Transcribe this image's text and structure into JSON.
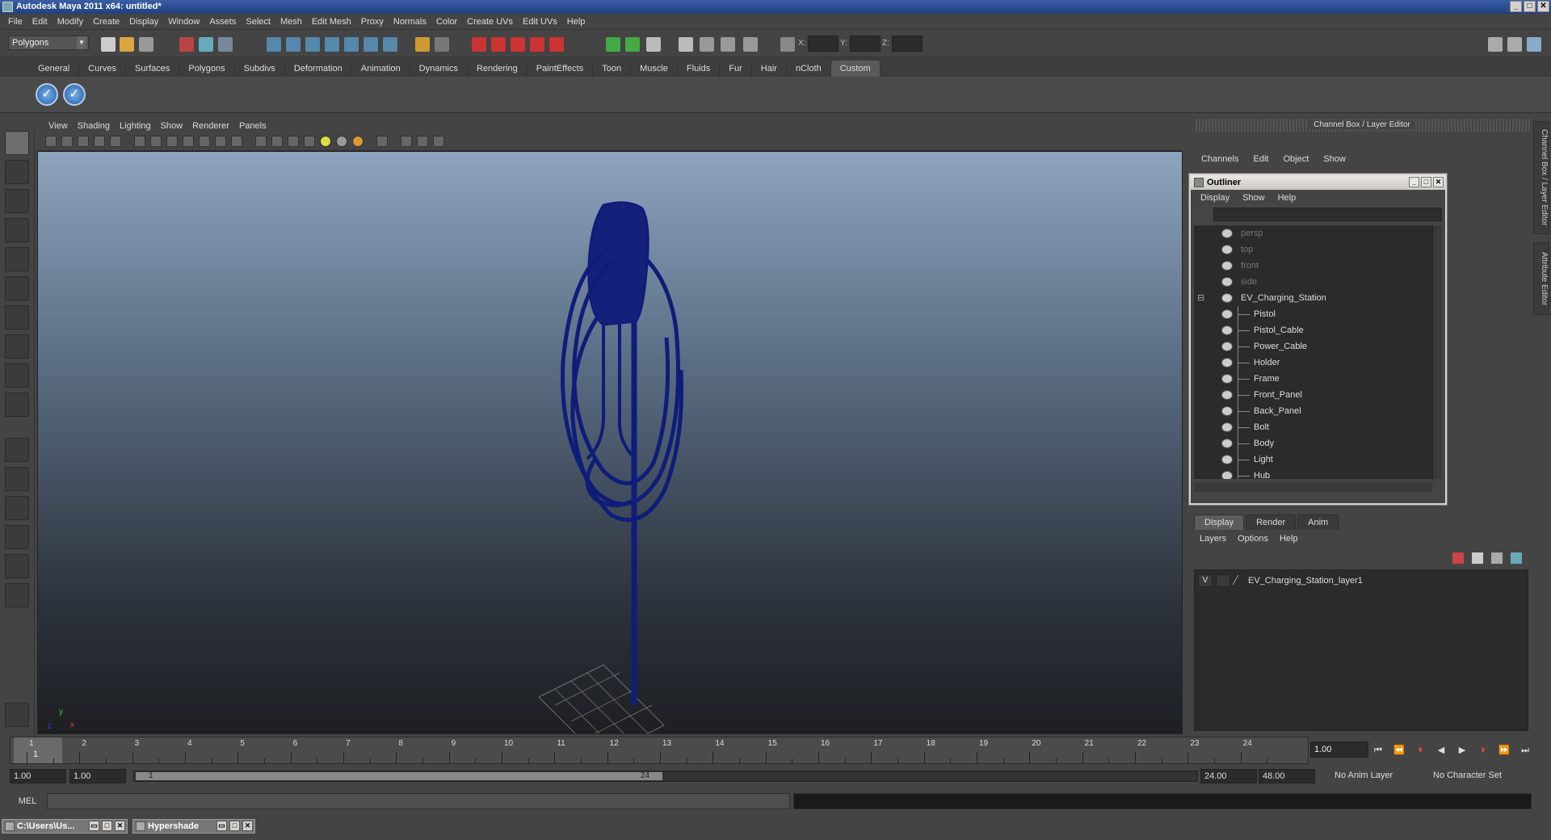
{
  "window": {
    "title": "Autodesk Maya 2011 x64: untitled*"
  },
  "menubar": [
    "File",
    "Edit",
    "Modify",
    "Create",
    "Display",
    "Window",
    "Assets",
    "Select",
    "Mesh",
    "Edit Mesh",
    "Proxy",
    "Normals",
    "Color",
    "Create UVs",
    "Edit UVs",
    "Help"
  ],
  "status": {
    "mode": "Polygons",
    "x_label": "X:",
    "y_label": "Y:",
    "z_label": "Z:"
  },
  "shelf": {
    "tabs": [
      "General",
      "Curves",
      "Surfaces",
      "Polygons",
      "Subdivs",
      "Deformation",
      "Animation",
      "Dynamics",
      "Rendering",
      "PaintEffects",
      "Toon",
      "Muscle",
      "Fluids",
      "Fur",
      "Hair",
      "nCloth",
      "Custom"
    ],
    "active_tab": "Custom"
  },
  "viewport": {
    "menu": [
      "View",
      "Shading",
      "Lighting",
      "Show",
      "Renderer",
      "Panels"
    ],
    "wire_color": "#0f1d7a"
  },
  "channelbox": {
    "title": "Channel Box / Layer Editor",
    "menu": [
      "Channels",
      "Edit",
      "Object",
      "Show"
    ]
  },
  "outliner": {
    "title": "Outliner",
    "menu": [
      "Display",
      "Show",
      "Help"
    ],
    "items": [
      {
        "label": "persp",
        "dim": true,
        "child": false
      },
      {
        "label": "top",
        "dim": true,
        "child": false
      },
      {
        "label": "front",
        "dim": true,
        "child": false
      },
      {
        "label": "side",
        "dim": true,
        "child": false
      },
      {
        "label": "EV_Charging_Station",
        "dim": false,
        "child": false,
        "group": true
      },
      {
        "label": "Pistol",
        "dim": false,
        "child": true
      },
      {
        "label": "Pistol_Cable",
        "dim": false,
        "child": true
      },
      {
        "label": "Power_Cable",
        "dim": false,
        "child": true
      },
      {
        "label": "Holder",
        "dim": false,
        "child": true
      },
      {
        "label": "Frame",
        "dim": false,
        "child": true
      },
      {
        "label": "Front_Panel",
        "dim": false,
        "child": true
      },
      {
        "label": "Back_Panel",
        "dim": false,
        "child": true
      },
      {
        "label": "Bolt",
        "dim": false,
        "child": true
      },
      {
        "label": "Body",
        "dim": false,
        "child": true
      },
      {
        "label": "Light",
        "dim": false,
        "child": true
      },
      {
        "label": "Hub",
        "dim": false,
        "child": true
      }
    ]
  },
  "layers": {
    "tabs": [
      "Display",
      "Render",
      "Anim"
    ],
    "menu": [
      "Layers",
      "Options",
      "Help"
    ],
    "rows": [
      {
        "visible": "V",
        "name": "EV_Charging_Station_layer1"
      }
    ]
  },
  "sidetabs": {
    "channel": "Channel Box / Layer Editor",
    "attribute": "Attribute Editor"
  },
  "timeline": {
    "frames": [
      "1",
      "2",
      "3",
      "4",
      "5",
      "6",
      "7",
      "8",
      "9",
      "10",
      "11",
      "12",
      "13",
      "14",
      "15",
      "16",
      "17",
      "18",
      "19",
      "20",
      "21",
      "22",
      "23",
      "24"
    ],
    "current": "1.00",
    "current_frame": "1"
  },
  "range": {
    "start": "1.00",
    "playback_start": "1.00",
    "range_start": "1",
    "range_end": "24",
    "playback_end": "24.00",
    "end": "48.00",
    "anim_layer": "No Anim Layer",
    "char_set": "No Character Set"
  },
  "cmd": {
    "lang": "MEL"
  },
  "taskbar": [
    {
      "label": "C:\\Users\\Us..."
    },
    {
      "label": "Hypershade"
    }
  ]
}
